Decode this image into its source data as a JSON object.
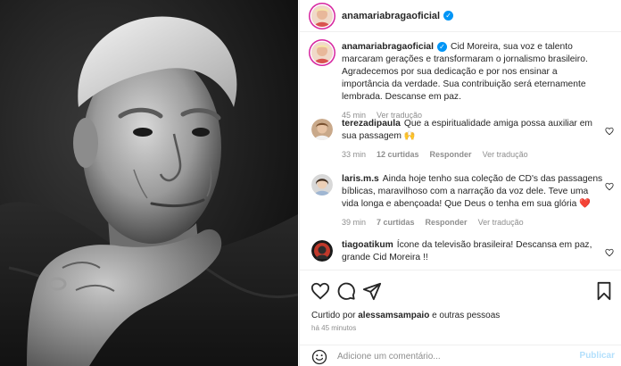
{
  "post": {
    "username": "anamariabragaoficial",
    "caption_author": "anamariabragaoficial",
    "caption": "Cid Moreira, sua voz e talento marcaram gerações e transformaram o jornalismo brasileiro. Agradecemos por sua dedicação e por nos ensinar a importância da verdade. Sua contribuição será eternamente lembrada. Descanse em paz.",
    "caption_time": "45 min",
    "caption_translate": "Ver tradução"
  },
  "comments": [
    {
      "author": "terezadipaula",
      "text": "Que a espiritualidade amiga possa auxiliar em sua passagem 🙌",
      "time": "33 min",
      "likes": "12 curtidas",
      "reply": "Responder",
      "translate": "Ver tradução"
    },
    {
      "author": "laris.m.s",
      "text": "Ainda hoje tenho sua coleção de CD's das passagens bíblicas, maravilhoso com a narração da voz dele. Teve uma vida longa e abençoada! Que Deus o tenha em sua glória ❤️",
      "time": "39 min",
      "likes": "7 curtidas",
      "reply": "Responder",
      "translate": "Ver tradução"
    },
    {
      "author": "tiagoatikum",
      "text": "Ícone da televisão brasileira! Descansa em paz, grande Cid Moreira !!"
    }
  ],
  "footer": {
    "liked_prefix": "Curtido por",
    "liked_user": "alessamsampaio",
    "liked_suffix": "e outras pessoas",
    "time": "há 45 minutos",
    "comment_placeholder": "Adicione um comentário...",
    "publish_label": "Publicar"
  },
  "icons": {
    "verified": "verified-badge-icon",
    "like": "heart-icon",
    "comment": "comment-icon",
    "share": "share-icon",
    "save": "bookmark-icon",
    "emoji": "emoji-icon",
    "more": "more-options-icon"
  },
  "colors": {
    "verified": "#0095f6",
    "text": "#262626",
    "muted": "#8e8e8e",
    "publish": "#b2dffc"
  }
}
